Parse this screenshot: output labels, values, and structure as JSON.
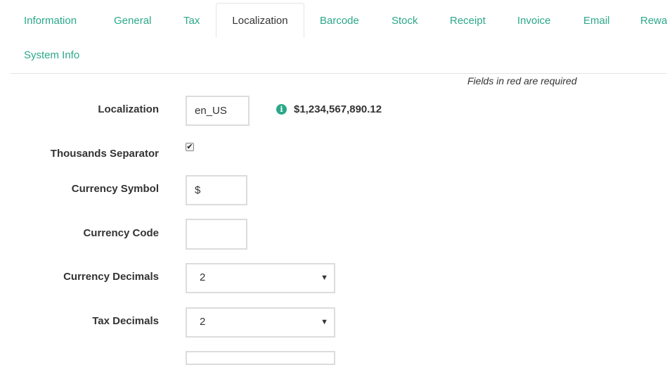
{
  "tabs": [
    {
      "label": "Information"
    },
    {
      "label": "General"
    },
    {
      "label": "Tax"
    },
    {
      "label": "Localization",
      "active": true
    },
    {
      "label": "Barcode"
    },
    {
      "label": "Stock"
    },
    {
      "label": "Receipt"
    },
    {
      "label": "Invoice"
    },
    {
      "label": "Email"
    },
    {
      "label": "Rewa"
    },
    {
      "label": "System Info"
    }
  ],
  "form": {
    "required_note": "Fields in red are required",
    "localization": {
      "label": "Localization",
      "value": "en_US"
    },
    "currency_preview": "$1,234,567,890.12",
    "info_icon": "info-circle-icon",
    "thousands_separator": {
      "label": "Thousands Separator",
      "checked": true
    },
    "currency_symbol": {
      "label": "Currency Symbol",
      "value": "$"
    },
    "currency_code": {
      "label": "Currency Code",
      "value": ""
    },
    "currency_decimals": {
      "label": "Currency Decimals",
      "selected": "2"
    },
    "tax_decimals": {
      "label": "Tax Decimals",
      "selected": "2"
    }
  },
  "colors": {
    "accent": "#2ba88a",
    "border": "#dcdcdc"
  }
}
